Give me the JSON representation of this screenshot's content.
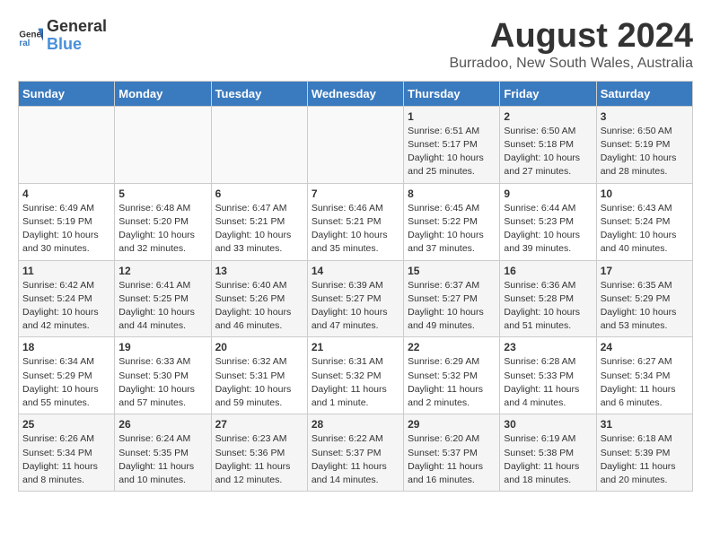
{
  "header": {
    "logo_general": "General",
    "logo_blue": "Blue",
    "title": "August 2024",
    "subtitle": "Burradoo, New South Wales, Australia"
  },
  "weekdays": [
    "Sunday",
    "Monday",
    "Tuesday",
    "Wednesday",
    "Thursday",
    "Friday",
    "Saturday"
  ],
  "weeks": [
    [
      {
        "day": "",
        "sunrise": "",
        "sunset": "",
        "daylight": ""
      },
      {
        "day": "",
        "sunrise": "",
        "sunset": "",
        "daylight": ""
      },
      {
        "day": "",
        "sunrise": "",
        "sunset": "",
        "daylight": ""
      },
      {
        "day": "",
        "sunrise": "",
        "sunset": "",
        "daylight": ""
      },
      {
        "day": "1",
        "sunrise": "Sunrise: 6:51 AM",
        "sunset": "Sunset: 5:17 PM",
        "daylight": "Daylight: 10 hours and 25 minutes."
      },
      {
        "day": "2",
        "sunrise": "Sunrise: 6:50 AM",
        "sunset": "Sunset: 5:18 PM",
        "daylight": "Daylight: 10 hours and 27 minutes."
      },
      {
        "day": "3",
        "sunrise": "Sunrise: 6:50 AM",
        "sunset": "Sunset: 5:19 PM",
        "daylight": "Daylight: 10 hours and 28 minutes."
      }
    ],
    [
      {
        "day": "4",
        "sunrise": "Sunrise: 6:49 AM",
        "sunset": "Sunset: 5:19 PM",
        "daylight": "Daylight: 10 hours and 30 minutes."
      },
      {
        "day": "5",
        "sunrise": "Sunrise: 6:48 AM",
        "sunset": "Sunset: 5:20 PM",
        "daylight": "Daylight: 10 hours and 32 minutes."
      },
      {
        "day": "6",
        "sunrise": "Sunrise: 6:47 AM",
        "sunset": "Sunset: 5:21 PM",
        "daylight": "Daylight: 10 hours and 33 minutes."
      },
      {
        "day": "7",
        "sunrise": "Sunrise: 6:46 AM",
        "sunset": "Sunset: 5:21 PM",
        "daylight": "Daylight: 10 hours and 35 minutes."
      },
      {
        "day": "8",
        "sunrise": "Sunrise: 6:45 AM",
        "sunset": "Sunset: 5:22 PM",
        "daylight": "Daylight: 10 hours and 37 minutes."
      },
      {
        "day": "9",
        "sunrise": "Sunrise: 6:44 AM",
        "sunset": "Sunset: 5:23 PM",
        "daylight": "Daylight: 10 hours and 39 minutes."
      },
      {
        "day": "10",
        "sunrise": "Sunrise: 6:43 AM",
        "sunset": "Sunset: 5:24 PM",
        "daylight": "Daylight: 10 hours and 40 minutes."
      }
    ],
    [
      {
        "day": "11",
        "sunrise": "Sunrise: 6:42 AM",
        "sunset": "Sunset: 5:24 PM",
        "daylight": "Daylight: 10 hours and 42 minutes."
      },
      {
        "day": "12",
        "sunrise": "Sunrise: 6:41 AM",
        "sunset": "Sunset: 5:25 PM",
        "daylight": "Daylight: 10 hours and 44 minutes."
      },
      {
        "day": "13",
        "sunrise": "Sunrise: 6:40 AM",
        "sunset": "Sunset: 5:26 PM",
        "daylight": "Daylight: 10 hours and 46 minutes."
      },
      {
        "day": "14",
        "sunrise": "Sunrise: 6:39 AM",
        "sunset": "Sunset: 5:27 PM",
        "daylight": "Daylight: 10 hours and 47 minutes."
      },
      {
        "day": "15",
        "sunrise": "Sunrise: 6:37 AM",
        "sunset": "Sunset: 5:27 PM",
        "daylight": "Daylight: 10 hours and 49 minutes."
      },
      {
        "day": "16",
        "sunrise": "Sunrise: 6:36 AM",
        "sunset": "Sunset: 5:28 PM",
        "daylight": "Daylight: 10 hours and 51 minutes."
      },
      {
        "day": "17",
        "sunrise": "Sunrise: 6:35 AM",
        "sunset": "Sunset: 5:29 PM",
        "daylight": "Daylight: 10 hours and 53 minutes."
      }
    ],
    [
      {
        "day": "18",
        "sunrise": "Sunrise: 6:34 AM",
        "sunset": "Sunset: 5:29 PM",
        "daylight": "Daylight: 10 hours and 55 minutes."
      },
      {
        "day": "19",
        "sunrise": "Sunrise: 6:33 AM",
        "sunset": "Sunset: 5:30 PM",
        "daylight": "Daylight: 10 hours and 57 minutes."
      },
      {
        "day": "20",
        "sunrise": "Sunrise: 6:32 AM",
        "sunset": "Sunset: 5:31 PM",
        "daylight": "Daylight: 10 hours and 59 minutes."
      },
      {
        "day": "21",
        "sunrise": "Sunrise: 6:31 AM",
        "sunset": "Sunset: 5:32 PM",
        "daylight": "Daylight: 11 hours and 1 minute."
      },
      {
        "day": "22",
        "sunrise": "Sunrise: 6:29 AM",
        "sunset": "Sunset: 5:32 PM",
        "daylight": "Daylight: 11 hours and 2 minutes."
      },
      {
        "day": "23",
        "sunrise": "Sunrise: 6:28 AM",
        "sunset": "Sunset: 5:33 PM",
        "daylight": "Daylight: 11 hours and 4 minutes."
      },
      {
        "day": "24",
        "sunrise": "Sunrise: 6:27 AM",
        "sunset": "Sunset: 5:34 PM",
        "daylight": "Daylight: 11 hours and 6 minutes."
      }
    ],
    [
      {
        "day": "25",
        "sunrise": "Sunrise: 6:26 AM",
        "sunset": "Sunset: 5:34 PM",
        "daylight": "Daylight: 11 hours and 8 minutes."
      },
      {
        "day": "26",
        "sunrise": "Sunrise: 6:24 AM",
        "sunset": "Sunset: 5:35 PM",
        "daylight": "Daylight: 11 hours and 10 minutes."
      },
      {
        "day": "27",
        "sunrise": "Sunrise: 6:23 AM",
        "sunset": "Sunset: 5:36 PM",
        "daylight": "Daylight: 11 hours and 12 minutes."
      },
      {
        "day": "28",
        "sunrise": "Sunrise: 6:22 AM",
        "sunset": "Sunset: 5:37 PM",
        "daylight": "Daylight: 11 hours and 14 minutes."
      },
      {
        "day": "29",
        "sunrise": "Sunrise: 6:20 AM",
        "sunset": "Sunset: 5:37 PM",
        "daylight": "Daylight: 11 hours and 16 minutes."
      },
      {
        "day": "30",
        "sunrise": "Sunrise: 6:19 AM",
        "sunset": "Sunset: 5:38 PM",
        "daylight": "Daylight: 11 hours and 18 minutes."
      },
      {
        "day": "31",
        "sunrise": "Sunrise: 6:18 AM",
        "sunset": "Sunset: 5:39 PM",
        "daylight": "Daylight: 11 hours and 20 minutes."
      }
    ]
  ]
}
